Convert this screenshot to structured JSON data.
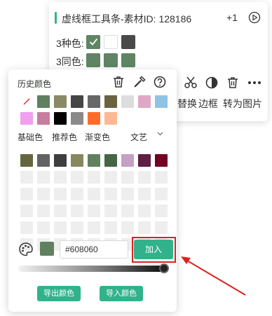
{
  "toolbar": {
    "title": "虚线框工具条-素材ID: 128186",
    "plus_count": "+1",
    "row1_label": "3种色:",
    "row2_label": "3同色:",
    "row1_colors": [
      "#5f8564",
      "#ffffff",
      "#4a4a4a"
    ],
    "row2_colors": [
      "#5f8564",
      "#5f8564",
      "#5f8564"
    ],
    "actions": [
      {
        "label": "替换",
        "icon": "replace-icon"
      },
      {
        "label": "边框",
        "icon": "contrast-icon"
      },
      {
        "label": "转为图片",
        "icon": "trash-icon"
      }
    ],
    "more_icon": "more-icon",
    "scissors_icon": "scissors-icon"
  },
  "panel": {
    "title": "历史颜色",
    "history_colors": [
      "none",
      "#608060",
      "#8a8a66",
      "#454545",
      "#676767",
      "#6a6342",
      "#dddddd",
      "#e0a8c6",
      "#8fc3e3",
      "#f0a0ef",
      "#c77e9e",
      "#000000",
      "#8a8a8a",
      "#ff6d2a",
      "#fdb894"
    ],
    "tabs": [
      "基础色",
      "推荐色",
      "渐变色"
    ],
    "theme_select": "文艺",
    "preset_colors": [
      "#656640",
      "#636363",
      "#3f3f3f",
      "#888860",
      "#608060",
      "#466646",
      "#c4a0c4",
      "#5e1f42",
      "#720024"
    ],
    "hex_value": "#608060",
    "current_color": "#608060",
    "add_label": "加入",
    "export_label": "导出颜色",
    "import_label": "导入颜色",
    "opacity_percent": 100
  },
  "accent": "#31b28a",
  "highlight": "#e02020"
}
